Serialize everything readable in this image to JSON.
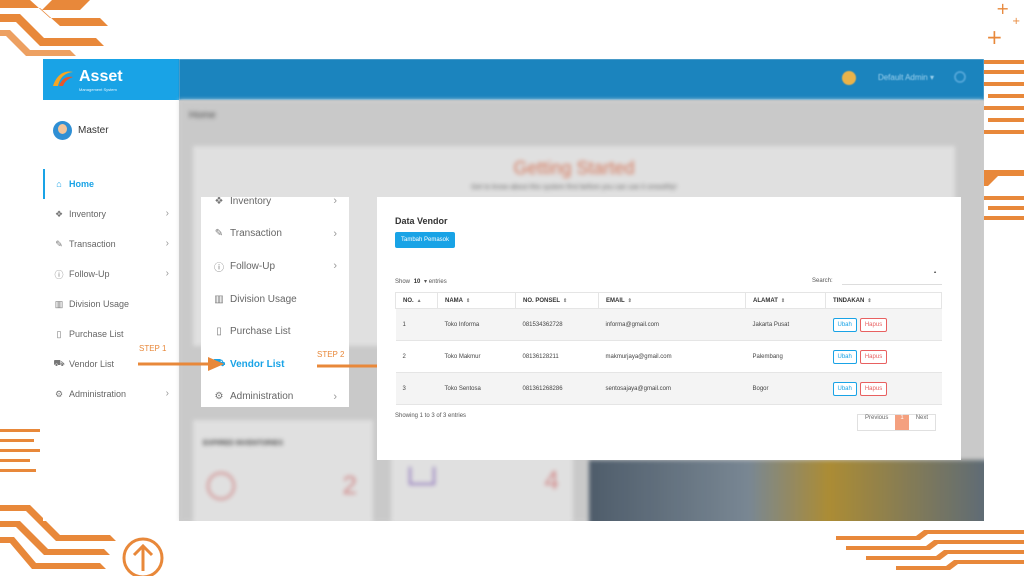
{
  "app": {
    "brand_name": "Asset",
    "brand_sub": "Management System",
    "top_user": "Default Admin ▾"
  },
  "profile": {
    "name": "Master"
  },
  "nav": {
    "items": [
      {
        "label": "Home",
        "icon": "home-icon"
      },
      {
        "label": "Inventory",
        "icon": "boxes-icon"
      },
      {
        "label": "Transaction",
        "icon": "edit-icon"
      },
      {
        "label": "Follow-Up",
        "icon": "info-icon"
      },
      {
        "label": "Division Usage",
        "icon": "bar-chart-icon"
      },
      {
        "label": "Purchase List",
        "icon": "clipboard-icon"
      },
      {
        "label": "Vendor List",
        "icon": "cart-icon"
      },
      {
        "label": "Administration",
        "icon": "gear-icon"
      }
    ]
  },
  "dashboard": {
    "breadcrumb": "Home",
    "title": "Getting Started",
    "subtitle": "Get to know about this system first before you can use it smoothly!",
    "card_expired_title": "EXPIRED INVENTORIES",
    "card_expired_count": "2",
    "card_cart_count": "4"
  },
  "steps": {
    "step1": "STEP 1",
    "step2": "STEP 2"
  },
  "vendor": {
    "title": "Data Vendor",
    "add_button": "Tambah Pemasok",
    "show_label": "Show",
    "show_value": "10",
    "entries_label": "entries",
    "search_label": "Search:",
    "columns": [
      "NO.",
      "NAMA",
      "NO. PONSEL",
      "EMAIL",
      "ALAMAT",
      "TINDAKAN"
    ],
    "rows": [
      {
        "no": "1",
        "nama": "Toko Informa",
        "ponsel": "081534362728",
        "email": "informa@gmail.com",
        "alamat": "Jakarta Pusat"
      },
      {
        "no": "2",
        "nama": "Toko Makmur",
        "ponsel": "08136128211",
        "email": "makmurjaya@gmail.com",
        "alamat": "Palembang"
      },
      {
        "no": "3",
        "nama": "Toko Sentosa",
        "ponsel": "081361268286",
        "email": "sentosajaya@gmail.com",
        "alamat": "Bogor"
      }
    ],
    "edit_label": "Ubah",
    "delete_label": "Hapus",
    "info": "Showing 1 to 3 of 3 entries",
    "prev": "Previous",
    "page": "1",
    "next": "Next"
  },
  "colors": {
    "accent": "#19a3e6",
    "step": "#e8883a",
    "danger": "#e86060",
    "page_active": "#f4a07f"
  }
}
